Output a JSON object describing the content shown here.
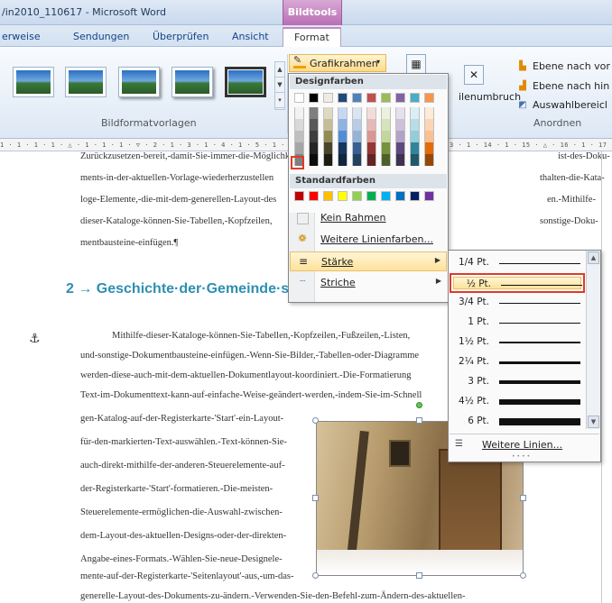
{
  "window": {
    "title": "/in2010_110617 - Microsoft Word",
    "context_tab": "Bildtools"
  },
  "tabs": {
    "items": [
      "erweise",
      "Sendungen",
      "Überprüfen",
      "Ansicht"
    ],
    "active": "Format"
  },
  "ribbon": {
    "bildformat_group_label": "Bildformatvorlagen",
    "anordnen_group_label": "Anordnen",
    "grafikrahmen_label": "Grafikrahmen",
    "ebene_vor": "Ebene nach vor",
    "ebene_hin": "Ebene nach hin",
    "auswahlbereich": "Auswahlbereicl",
    "zeilenumbruch": "ilenumbruch"
  },
  "ruler": {
    "scale_text": "1 · 1 · 1 · 1 · △ · 1 · 1 · 1 · ▽ · 2 · 1 · 3 · 1 · 4 · 1 · 5 · 1 · 6 · 1 · 7 · 1 ·"
  },
  "ruler_right": {
    "scale_text": "3 · 1 · 14 · 1 · 15 · △ · 16 · 1 · 17 · 1 ·"
  },
  "document": {
    "para_lines": [
      "Zurückzusetzen-bereit,-damit-Sie-immer-die-Möglichkeit",
      "ments-in-der-aktuellen-Vorlage-wiederherzustellen",
      "loge-Elemente,-die-mit-dem-generellen-Layout-des",
      "dieser-Kataloge-können-Sie-Tabellen,-Kopfzeilen,",
      "mentbausteine-einfügen.¶"
    ],
    "para_right_fragments": [
      "ist-des-Doku-",
      "thalten-die-Kata-",
      "en.-Mithilfe-",
      "sonstige-Doku-"
    ],
    "heading": "2 → Geschichte·der·Gemeinde·seit·1900¶",
    "body_lines": [
      "Mithilfe-dieser-Kataloge-können-Sie-Tabellen,-Kopfzeilen,-Fußzeilen,-Listen,",
      "und-sonstige-Dokumentbausteine-einfügen.-Wenn-Sie-Bilder,-Tabellen-oder-Diagramme",
      "werden-diese-auch-mit-dem-aktuellen-Dokumentlayout-koordiniert.-Die-Formatierung",
      "Text-im-Dokumenttext-kann-auf-einfache-Weise-geändert-werden,-indem-Sie-im-Schnell",
      "gen-Katalog-auf-der-Registerkarte-'Start'-ein-Layout-",
      "für-den-markierten-Text-auswählen.-Text-können-Sie-",
      "auch-direkt-mithilfe-der-anderen-Steuerelemente-auf-",
      "der-Registerkarte-'Start'-formatieren.-Die-meisten-",
      "Steuerelemente-ermöglichen-die-Auswahl-zwischen-",
      "dem-Layout-des-aktuellen-Designs-oder-der-direkten-",
      "Angabe-eines-Formats.-Wählen-Sie-neue-Designele-",
      "mente-auf-der-Registerkarte-'Seitenlayout'-aus,-um-das-",
      "generelle-Layout-des-Dokuments-zu-ändern.-Verwenden-Sie-den-Befehl-zum-Ändern-des-aktuellen-"
    ]
  },
  "dropdown": {
    "designfarben_header": "Designfarben",
    "standardfarben_header": "Standardfarben",
    "kein_rahmen": "Kein Rahmen",
    "weitere_linienfarben": "Weitere Linienfarben...",
    "staerke": "Stärke",
    "striche": "Striche",
    "theme_top_row": [
      "#ffffff",
      "#000000",
      "#eeece1",
      "#1f497d",
      "#4f81bd",
      "#c0504d",
      "#9bbb59",
      "#8064a2",
      "#4bacc6",
      "#f79646"
    ],
    "theme_columns": [
      [
        "#f2f2f2",
        "#d9d9d9",
        "#bfbfbf",
        "#a6a6a6",
        "#808080"
      ],
      [
        "#7f7f7f",
        "#595959",
        "#3f3f3f",
        "#262626",
        "#0d0d0d"
      ],
      [
        "#ddd9c3",
        "#c4bd97",
        "#948a54",
        "#4a452a",
        "#1e1c11"
      ],
      [
        "#c6d9f0",
        "#8db3e2",
        "#548dd4",
        "#17365d",
        "#0f243e"
      ],
      [
        "#dbe5f1",
        "#b8cce4",
        "#95b3d7",
        "#366092",
        "#244061"
      ],
      [
        "#f2dcdb",
        "#e5b9b7",
        "#d99694",
        "#953734",
        "#632423"
      ],
      [
        "#ebf1dd",
        "#d7e3bc",
        "#c3d69b",
        "#76923c",
        "#4f6128"
      ],
      [
        "#e5e0ec",
        "#ccc1d9",
        "#b2a2c7",
        "#5f497a",
        "#3f3151"
      ],
      [
        "#dbeef3",
        "#b7dde8",
        "#92cddc",
        "#31859b",
        "#205867"
      ],
      [
        "#fdeada",
        "#fbd5b5",
        "#fac08f",
        "#e36c09",
        "#974806"
      ]
    ],
    "standard_colors": [
      "#c00000",
      "#ff0000",
      "#ffc000",
      "#ffff00",
      "#92d050",
      "#00b050",
      "#00b0f0",
      "#0070c0",
      "#002060",
      "#7030a0"
    ]
  },
  "weights": {
    "items": [
      {
        "label": "1/4 Pt.",
        "thickness": 0.25
      },
      {
        "label": "½ Pt.",
        "thickness": 0.5
      },
      {
        "label": "3/4 Pt.",
        "thickness": 0.75
      },
      {
        "label": "1 Pt.",
        "thickness": 1
      },
      {
        "label": "1½ Pt.",
        "thickness": 1.5
      },
      {
        "label": "2¼ Pt.",
        "thickness": 2.25
      },
      {
        "label": "3 Pt.",
        "thickness": 3
      },
      {
        "label": "4½ Pt.",
        "thickness": 4.5
      },
      {
        "label": "6 Pt.",
        "thickness": 6
      }
    ],
    "selected": "½ Pt.",
    "weitere_linien": "Weitere Linien..."
  }
}
